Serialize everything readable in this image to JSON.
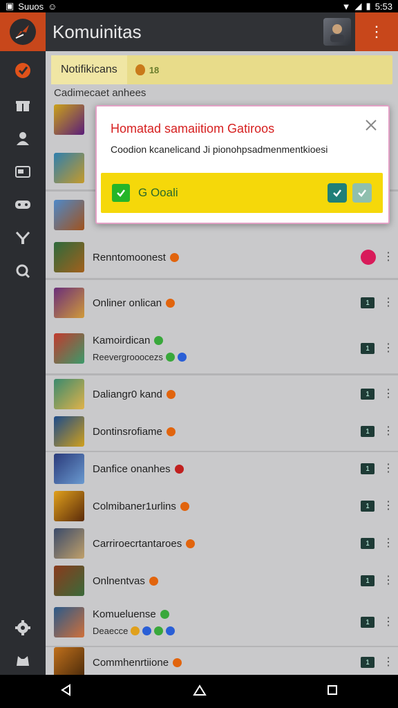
{
  "status": {
    "left_text": "Suuos",
    "right_text": "5:53"
  },
  "appbar": {
    "title": "Komuinitas"
  },
  "colors": {
    "accent": "#c8471b",
    "dialog_action": "#f5d80a",
    "badge": "#1e3b36",
    "title_red": "#d61f1f"
  },
  "notifications": {
    "tab_label": "Notifikicans",
    "count": "18"
  },
  "section": {
    "label": "Cadimecaet anhees"
  },
  "dialog": {
    "title": "Homatad samaiitiom Gatiroos",
    "message": "Coodion kcanelicand Ji pionohpsadmenmentkioesi",
    "action_label": "G Ooali"
  },
  "sidebar": {
    "items": [
      {
        "icon": "check-circle-icon"
      },
      {
        "icon": "gift-icon"
      },
      {
        "icon": "person-icon"
      },
      {
        "icon": "card-icon"
      },
      {
        "icon": "gamepad-icon"
      },
      {
        "icon": "swords-icon"
      },
      {
        "icon": "search-icon"
      },
      {
        "icon": "settings-icon"
      },
      {
        "icon": "cat-icon"
      }
    ]
  },
  "rows": [
    {
      "name": "Renntomoonest",
      "dot": "#e1640d",
      "action": "pink-toggle"
    },
    {
      "name": "Onliner onlican",
      "dot": "#e1640d",
      "badge": "1"
    },
    {
      "name": "Kamoirdican",
      "dot": "#39a83b",
      "sub": "Reevergrooocezs",
      "badge": "1"
    },
    {
      "name": "Daliangr0 kand",
      "dot": "#e1640d",
      "badge": "1"
    },
    {
      "name": "Dontinsrofiame",
      "dot": "#e1640d",
      "badge": "1"
    },
    {
      "name": "Danfice onanhes",
      "dot": "#c0201f",
      "badge": "1"
    },
    {
      "name": "Colmibaner1urlins",
      "dot": "#e1640d",
      "badge": "1"
    },
    {
      "name": "Carriroecrtantaroes",
      "dot": "#e1640d",
      "badge": "1"
    },
    {
      "name": "Onlnentvas",
      "dot": "#e1640d",
      "badge": "1"
    },
    {
      "name": "Komueluense",
      "dot": "#39a83b",
      "sub": "Deaecce",
      "badge": "1"
    },
    {
      "name": "Commhenrtiione",
      "dot": "#e1640d",
      "badge": "1"
    }
  ]
}
